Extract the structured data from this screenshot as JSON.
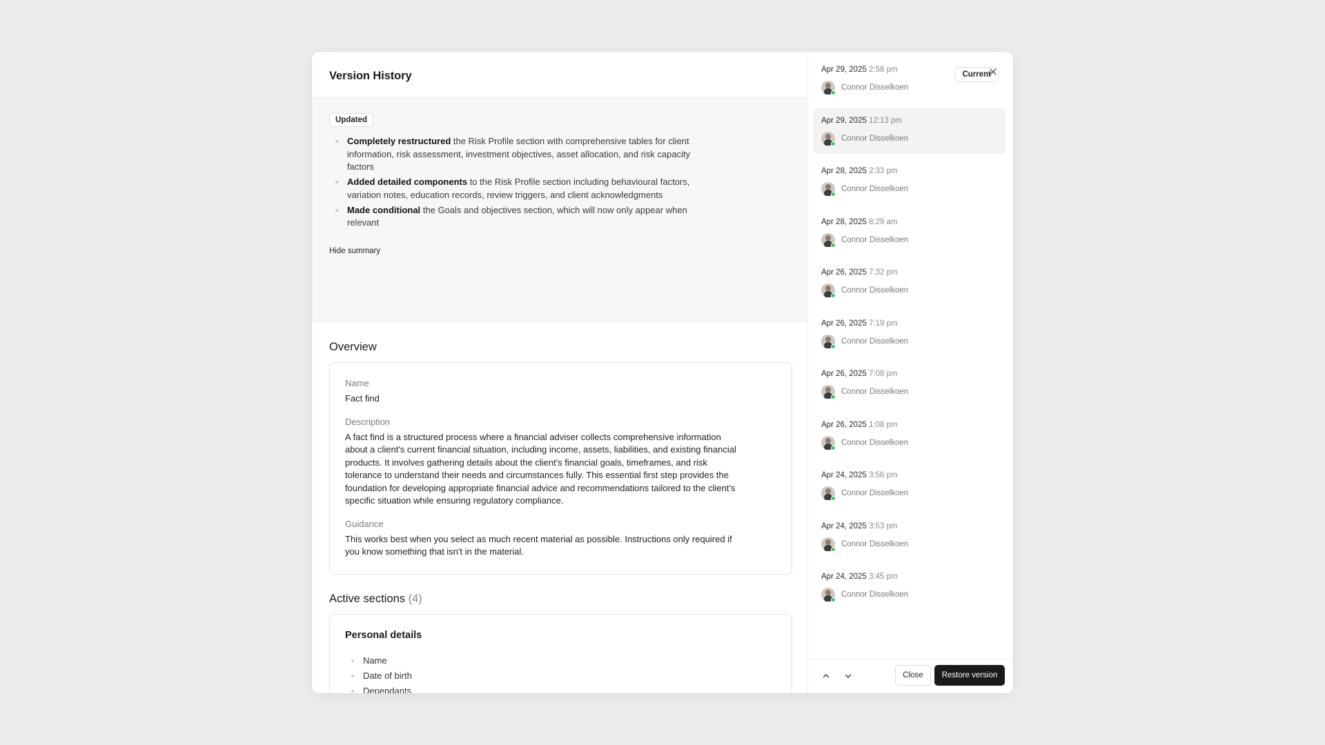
{
  "modal": {
    "title": "Version History"
  },
  "summary": {
    "badge": "Updated",
    "items": [
      {
        "bold": "Completely restructured",
        "rest": " the Risk Profile section with comprehensive tables for client information, risk assessment, investment objectives, asset allocation, and risk capacity factors"
      },
      {
        "bold": "Added detailed components",
        "rest": " to the Risk Profile section including behavioural factors, variation notes, education records, review triggers, and client acknowledgments"
      },
      {
        "bold": "Made conditional",
        "rest": " the Goals and objectives section, which will now only appear when relevant"
      }
    ],
    "hide_label": "Hide summary"
  },
  "overview": {
    "title": "Overview",
    "name_label": "Name",
    "name_value": "Fact find",
    "description_label": "Description",
    "description_value": "A fact find is a structured process where a financial adviser collects comprehensive information about a client's current financial situation, including income, assets, liabilities, and existing financial products. It involves gathering details about the client's financial goals, timeframes, and risk tolerance to understand their needs and circumstances fully. This essential first step provides the foundation for developing appropriate financial advice and recommendations tailored to the client's specific situation while ensuring regulatory compliance.",
    "guidance_label": "Guidance",
    "guidance_value": "This works best when you select as much recent material as possible. Instructions only required if you know something that isn't in the material."
  },
  "active_sections": {
    "title": "Active sections",
    "count": "(4)",
    "personal_details": {
      "title": "Personal details",
      "items": [
        "Name",
        "Date of birth",
        "Dependants"
      ]
    }
  },
  "versions": {
    "current_label": "Current",
    "items": [
      {
        "date": "Apr 29, 2025",
        "time": "2:58 pm",
        "user": "Connor Disselkoen"
      },
      {
        "date": "Apr 29, 2025",
        "time": "12:13 pm",
        "user": "Connor Disselkoen"
      },
      {
        "date": "Apr 28, 2025",
        "time": "2:33 pm",
        "user": "Connor Disselkoen"
      },
      {
        "date": "Apr 28, 2025",
        "time": "8:29 am",
        "user": "Connor Disselkoen"
      },
      {
        "date": "Apr 26, 2025",
        "time": "7:32 pm",
        "user": "Connor Disselkoen"
      },
      {
        "date": "Apr 26, 2025",
        "time": "7:19 pm",
        "user": "Connor Disselkoen"
      },
      {
        "date": "Apr 26, 2025",
        "time": "7:08 pm",
        "user": "Connor Disselkoen"
      },
      {
        "date": "Apr 26, 2025",
        "time": "1:08 pm",
        "user": "Connor Disselkoen"
      },
      {
        "date": "Apr 24, 2025",
        "time": "3:56 pm",
        "user": "Connor Disselkoen"
      },
      {
        "date": "Apr 24, 2025",
        "time": "3:53 pm",
        "user": "Connor Disselkoen"
      },
      {
        "date": "Apr 24, 2025",
        "time": "3:45 pm",
        "user": "Connor Disselkoen"
      }
    ]
  },
  "footer": {
    "close_label": "Close",
    "restore_label": "Restore version"
  },
  "icons": {
    "close": "close-icon",
    "up": "chevron-up-icon",
    "down": "chevron-down-icon",
    "status_color": "#36c46a"
  }
}
